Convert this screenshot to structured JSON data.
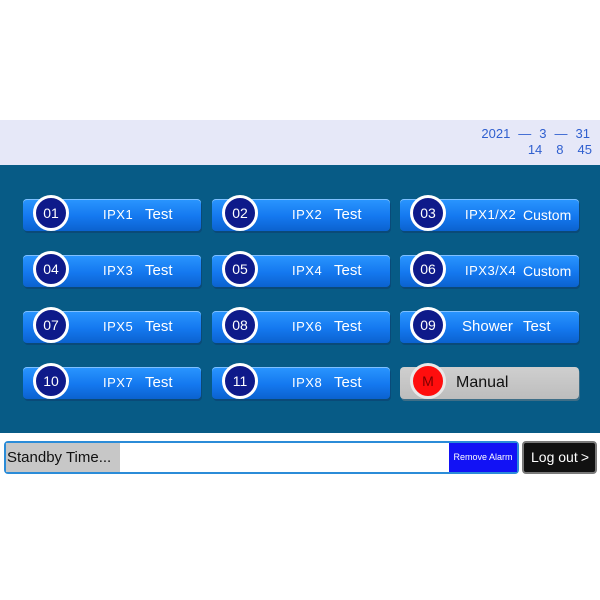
{
  "header": {
    "date": {
      "year": "2021",
      "sep1": "—",
      "month": "3",
      "sep2": "—",
      "day": "31"
    },
    "time": {
      "hour": "14",
      "minute": "8",
      "second": "45"
    }
  },
  "tests": [
    {
      "num": "01",
      "code": "IPX1",
      "mode": "Test"
    },
    {
      "num": "02",
      "code": "IPX2",
      "mode": "Test"
    },
    {
      "num": "03",
      "code": "IPX1/X2",
      "mode": "Custom"
    },
    {
      "num": "04",
      "code": "IPX3",
      "mode": "Test"
    },
    {
      "num": "05",
      "code": "IPX4",
      "mode": "Test"
    },
    {
      "num": "06",
      "code": "IPX3/X4",
      "mode": "Custom"
    },
    {
      "num": "07",
      "code": "IPX5",
      "mode": "Test"
    },
    {
      "num": "08",
      "code": "IPX6",
      "mode": "Test"
    },
    {
      "num": "09",
      "code": "Shower",
      "mode": "Test"
    },
    {
      "num": "10",
      "code": "IPX7",
      "mode": "Test"
    },
    {
      "num": "11",
      "code": "IPX8",
      "mode": "Test"
    },
    {
      "num": "M",
      "code": "Manual",
      "mode": ""
    }
  ],
  "status": {
    "standby": "Standby Time...",
    "message": ""
  },
  "actions": {
    "remove_alarm": "Remove Alarm",
    "logout": "Log out",
    "logout_icon": "chevron-right-icon"
  },
  "colors": {
    "panel": "#075b86",
    "button": "#1478ef",
    "badge": "#0e1a8a",
    "manual_badge": "#ff0d0d",
    "remove": "#1212f5"
  }
}
